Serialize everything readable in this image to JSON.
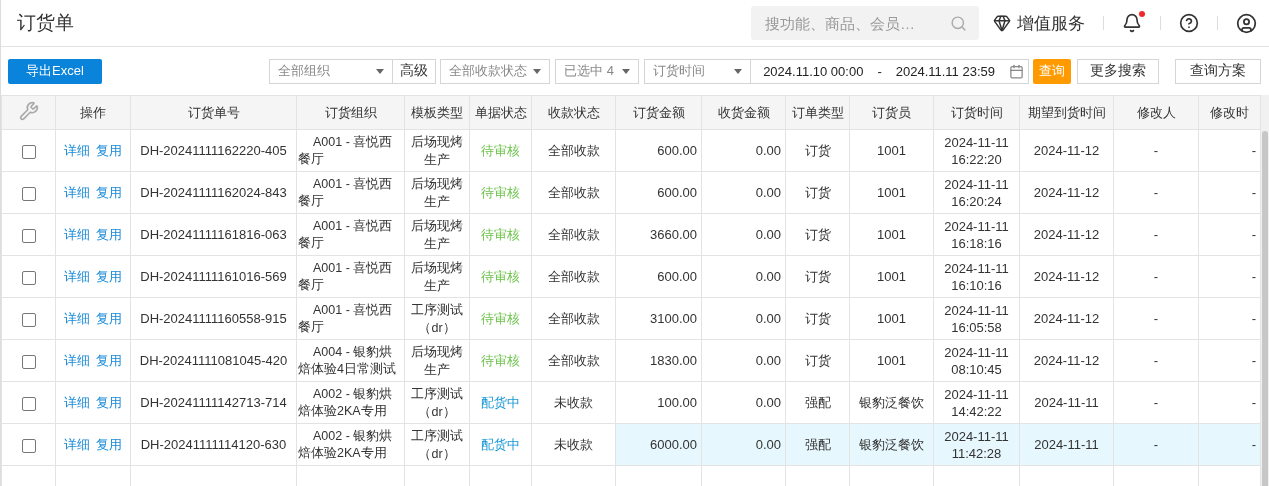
{
  "header": {
    "title": "订货单",
    "search": {
      "placeholder": "搜功能、商品、会员…"
    },
    "value_service": "增值服务",
    "notifications": {
      "unread": true
    }
  },
  "toolbar": {
    "export_button": "导出Excel",
    "org_select": "全部组织",
    "advanced_button": "高级",
    "payment_select": "全部收款状态",
    "status_select": "已选中 4",
    "time_select": "订货时间",
    "date_from": "2024.11.10 00:00",
    "date_separator": "-",
    "date_to": "2024.11.11 23:59",
    "query_button": "查询",
    "more_search_button": "更多搜索",
    "scheme_button": "查询方案"
  },
  "table": {
    "columns": [
      "操作",
      "订货单号",
      "订货组织",
      "模板类型",
      "单据状态",
      "收款状态",
      "订货金额",
      "收货金额",
      "订单类型",
      "订货员",
      "订货时间",
      "期望到货时间",
      "修改人",
      "修改时"
    ],
    "rows": [
      {
        "checked": false,
        "highlighted": false,
        "actions": [
          "详细",
          "复用"
        ],
        "order_no": "DH-20241111162220-405",
        "org": "A001 - 喜悦西餐厅",
        "template": "后场现烤生产",
        "status": {
          "text": "待审核",
          "color": "#6cc24a"
        },
        "payment": "全部收款",
        "amount": "600.00",
        "received": "0.00",
        "type": "订货",
        "orderer": "1001",
        "order_time": "2024-11-11 16:22:20",
        "expected": "2024-11-12",
        "modifier": "-",
        "modified": "-"
      },
      {
        "checked": false,
        "highlighted": false,
        "actions": [
          "详细",
          "复用"
        ],
        "order_no": "DH-20241111162024-843",
        "org": "A001 - 喜悦西餐厅",
        "template": "后场现烤生产",
        "status": {
          "text": "待审核",
          "color": "#6cc24a"
        },
        "payment": "全部收款",
        "amount": "600.00",
        "received": "0.00",
        "type": "订货",
        "orderer": "1001",
        "order_time": "2024-11-11 16:20:24",
        "expected": "2024-11-12",
        "modifier": "-",
        "modified": "-"
      },
      {
        "checked": false,
        "highlighted": false,
        "actions": [
          "详细",
          "复用"
        ],
        "order_no": "DH-20241111161816-063",
        "org": "A001 - 喜悦西餐厅",
        "template": "后场现烤生产",
        "status": {
          "text": "待审核",
          "color": "#6cc24a"
        },
        "payment": "全部收款",
        "amount": "3660.00",
        "received": "0.00",
        "type": "订货",
        "orderer": "1001",
        "order_time": "2024-11-11 16:18:16",
        "expected": "2024-11-12",
        "modifier": "-",
        "modified": "-"
      },
      {
        "checked": false,
        "highlighted": false,
        "actions": [
          "详细",
          "复用"
        ],
        "order_no": "DH-20241111161016-569",
        "org": "A001 - 喜悦西餐厅",
        "template": "后场现烤生产",
        "status": {
          "text": "待审核",
          "color": "#6cc24a"
        },
        "payment": "全部收款",
        "amount": "600.00",
        "received": "0.00",
        "type": "订货",
        "orderer": "1001",
        "order_time": "2024-11-11 16:10:16",
        "expected": "2024-11-12",
        "modifier": "-",
        "modified": "-"
      },
      {
        "checked": false,
        "highlighted": false,
        "actions": [
          "详细",
          "复用"
        ],
        "order_no": "DH-20241111160558-915",
        "org": "A001 - 喜悦西餐厅",
        "template": "工序测试（dr）",
        "status": {
          "text": "待审核",
          "color": "#6cc24a"
        },
        "payment": "全部收款",
        "amount": "3100.00",
        "received": "0.00",
        "type": "订货",
        "orderer": "1001",
        "order_time": "2024-11-11 16:05:58",
        "expected": "2024-11-12",
        "modifier": "-",
        "modified": "-"
      },
      {
        "checked": false,
        "highlighted": false,
        "actions": [
          "详细",
          "复用"
        ],
        "order_no": "DH-20241111081045-420",
        "org": "A004 - 银豹烘焙体验4日常测试",
        "template": "后场现烤生产",
        "status": {
          "text": "待审核",
          "color": "#6cc24a"
        },
        "payment": "全部收款",
        "amount": "1830.00",
        "received": "0.00",
        "type": "订货",
        "orderer": "1001",
        "order_time": "2024-11-11 08:10:45",
        "expected": "2024-11-12",
        "modifier": "-",
        "modified": "-"
      },
      {
        "checked": false,
        "highlighted": false,
        "actions": [
          "详细",
          "复用"
        ],
        "order_no": "DH-20241111142713-714",
        "org": "A002 - 银豹烘焙体验2KA专用",
        "template": "工序测试（dr）",
        "status": {
          "text": "配货中",
          "color": "#1a98d5"
        },
        "payment": "未收款",
        "amount": "100.00",
        "received": "0.00",
        "type": "强配",
        "orderer": "银豹泛餐饮",
        "order_time": "2024-11-11 14:42:22",
        "expected": "2024-11-11",
        "modifier": "-",
        "modified": "-"
      },
      {
        "checked": false,
        "highlighted": true,
        "actions": [
          "详细",
          "复用"
        ],
        "order_no": "DH-20241111114120-630",
        "org": "A002 - 银豹烘焙体验2KA专用",
        "template": "工序测试（dr）",
        "status": {
          "text": "配货中",
          "color": "#1a98d5"
        },
        "payment": "未收款",
        "amount": "6000.00",
        "received": "0.00",
        "type": "强配",
        "orderer": "银豹泛餐饮",
        "order_time": "2024-11-11 11:42:28",
        "expected": "2024-11-11",
        "modifier": "-",
        "modified": "-"
      }
    ]
  }
}
